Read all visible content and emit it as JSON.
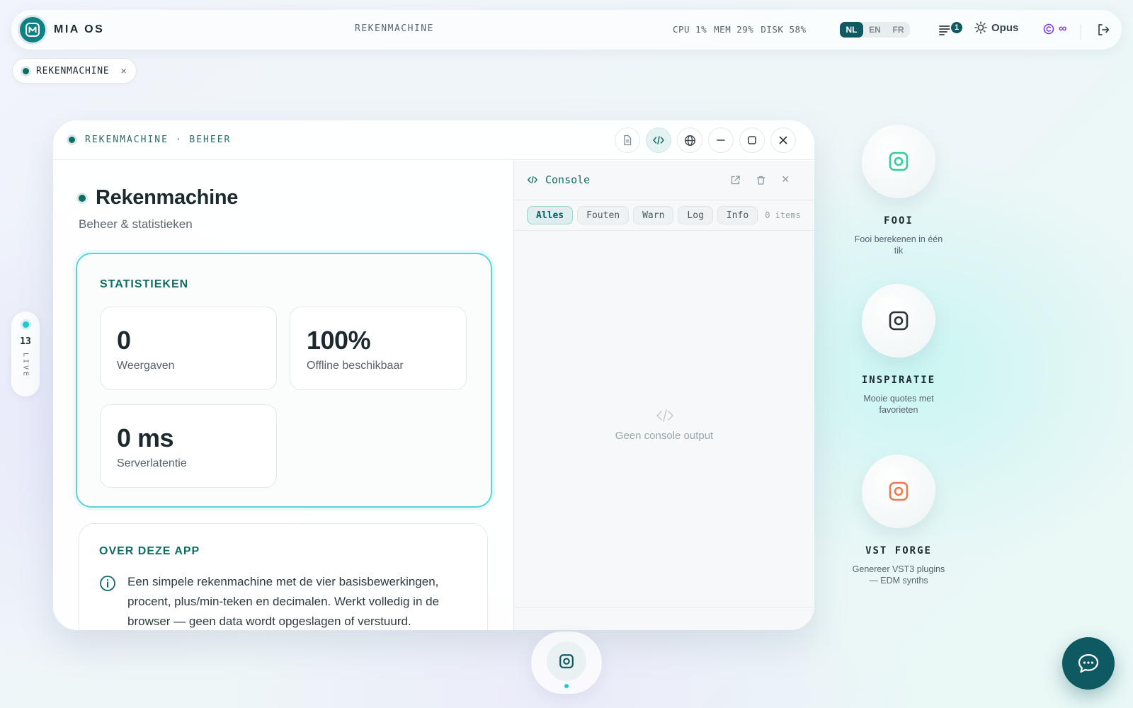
{
  "topbar": {
    "brand": "MIA OS",
    "title": "REKENMACHINE",
    "stats": [
      "CPU 1%",
      "MEM 29%",
      "DISK 58%"
    ],
    "languages": [
      {
        "code": "NL",
        "active": true
      },
      {
        "code": "EN",
        "active": false
      },
      {
        "code": "FR",
        "active": false
      }
    ],
    "notification_count": "1",
    "model": "Opus",
    "credits": "∞"
  },
  "tab": {
    "label": "REKENMACHINE",
    "close": "×"
  },
  "live": {
    "count": "13",
    "label": "LIVE"
  },
  "window": {
    "title": "REKENMACHINE · BEHEER",
    "app": {
      "title": "Rekenmachine",
      "subtitle": "Beheer & statistieken",
      "stats_title": "STATISTIEKEN",
      "stats": [
        {
          "value": "0",
          "label": "Weergaven"
        },
        {
          "value": "100%",
          "label": "Offline beschikbaar"
        },
        {
          "value": "0 ms",
          "label": "Serverlatentie"
        }
      ],
      "about_title": "OVER DEZE APP",
      "about_text": "Een simpele rekenmachine met de vier basisbewerkingen, procent, plus/min-teken en decimalen. Werkt volledig in de browser — geen data wordt opgeslagen of verstuurd."
    },
    "console": {
      "title": "Console",
      "filters": [
        "Alles",
        "Fouten",
        "Warn",
        "Log",
        "Info"
      ],
      "active_filter": "Alles",
      "count": "0 items",
      "empty": "Geen console output",
      "close": "×"
    }
  },
  "shortcuts": [
    {
      "name": "FOOI",
      "desc": "Fooi berekenen in één tik",
      "color": "#2ecf9c"
    },
    {
      "name": "INSPIRATIE",
      "desc": "Mooie quotes met favorieten",
      "color": "#2b3438"
    },
    {
      "name": "VST FORGE",
      "desc": "Genereer VST3 plugins — EDM synths",
      "color": "#f07a4a"
    }
  ],
  "colors": {
    "accent": "#0f5a62",
    "teal": "#0f6e63",
    "highlight": "#5dd3d9",
    "credits": "#7c3aed"
  }
}
